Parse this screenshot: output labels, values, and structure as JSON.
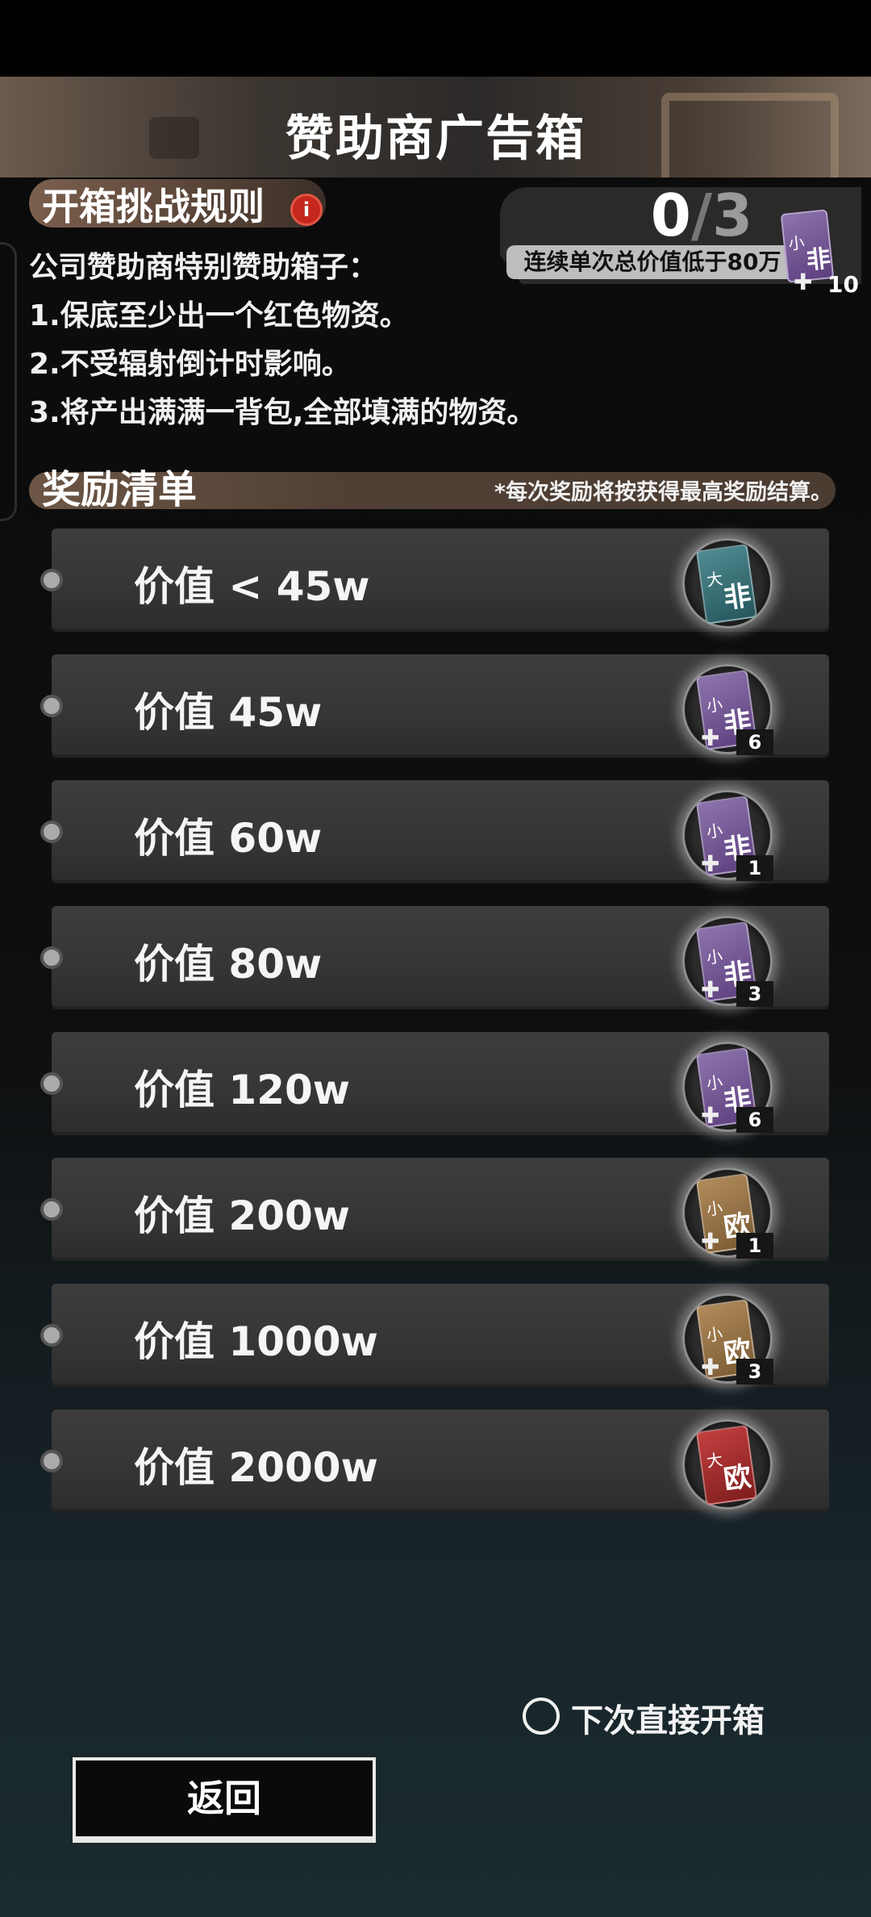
{
  "header": {
    "title": "赞助商广告箱"
  },
  "rules": {
    "title": "开箱挑战规则",
    "info_icon": "i",
    "lines": [
      "公司赞助商特别赞助箱子：",
      "1.保底至少出一个红色物资。",
      "2.不受辐射倒计时影响。",
      "3.将产出满满一背包,全部填满的物资。"
    ]
  },
  "challenge": {
    "current": "0",
    "slash": "/",
    "total": "3",
    "description": "连续单次总价值低于80万",
    "card_small": "小",
    "card_big": "非",
    "reward_qty": "10"
  },
  "rewards": {
    "title": "奖励清单",
    "note": "*每次奖励将按获得最高奖励结算。",
    "items": [
      {
        "label": "价值 < 45w",
        "card_small": "大",
        "card_big": "非",
        "card_color": "teal",
        "qty": ""
      },
      {
        "label": "价值 45w",
        "card_small": "小",
        "card_big": "非",
        "card_color": "purple",
        "qty": "6"
      },
      {
        "label": "价值 60w",
        "card_small": "小",
        "card_big": "非",
        "card_color": "purple",
        "qty": "1"
      },
      {
        "label": "价值 80w",
        "card_small": "小",
        "card_big": "非",
        "card_color": "purple",
        "qty": "3"
      },
      {
        "label": "价值 120w",
        "card_small": "小",
        "card_big": "非",
        "card_color": "purple",
        "qty": "6"
      },
      {
        "label": "价值 200w",
        "card_small": "小",
        "card_big": "欧",
        "card_color": "gold",
        "qty": "1"
      },
      {
        "label": "价值 1000w",
        "card_small": "小",
        "card_big": "欧",
        "card_color": "gold",
        "qty": "3"
      },
      {
        "label": "价值 2000w",
        "card_small": "大",
        "card_big": "欧",
        "card_color": "red",
        "qty": ""
      }
    ]
  },
  "footer": {
    "skip_label": "下次直接开箱",
    "back_label": "返回"
  }
}
